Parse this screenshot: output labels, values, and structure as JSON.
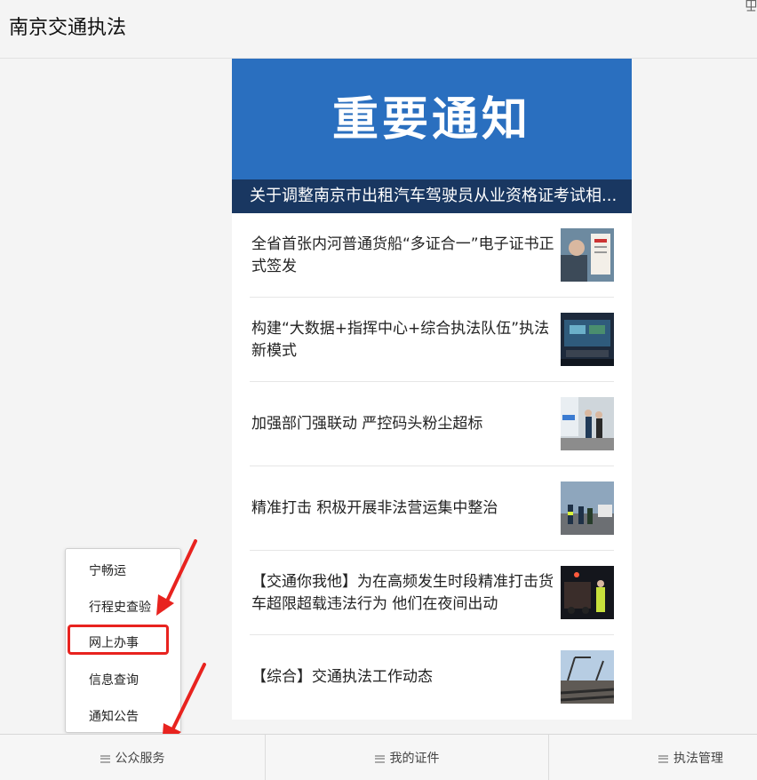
{
  "app": {
    "title": "南京交通执法",
    "pin_glyph": "⯶"
  },
  "banner": {
    "heading": "重要通知",
    "caption": "关于调整南京市出租汽车驾驶员从业资格证考试相..."
  },
  "news": [
    {
      "title": "全省首张内河普通货船“多证合一”电子证书正式签发"
    },
    {
      "title": "构建“大数据+指挥中心+综合执法队伍”执法新模式"
    },
    {
      "title": "加强部门强联动 严控码头粉尘超标"
    },
    {
      "title": "精准打击 积极开展非法营运集中整治"
    },
    {
      "title": "【交通你我他】为在高频发生时段精准打击货车超限超载违法行为 他们在夜间出动"
    },
    {
      "title": "【综合】交通执法工作动态"
    }
  ],
  "popup_menu": {
    "items": [
      "宁畅运",
      "行程史查验",
      "网上办事",
      "信息查询",
      "通知公告"
    ]
  },
  "tabbar": {
    "tabs": [
      "公众服务",
      "我的证件",
      "执法管理"
    ]
  },
  "colors": {
    "banner_blue": "#2a6fbf",
    "highlight_red": "#e8231f"
  }
}
